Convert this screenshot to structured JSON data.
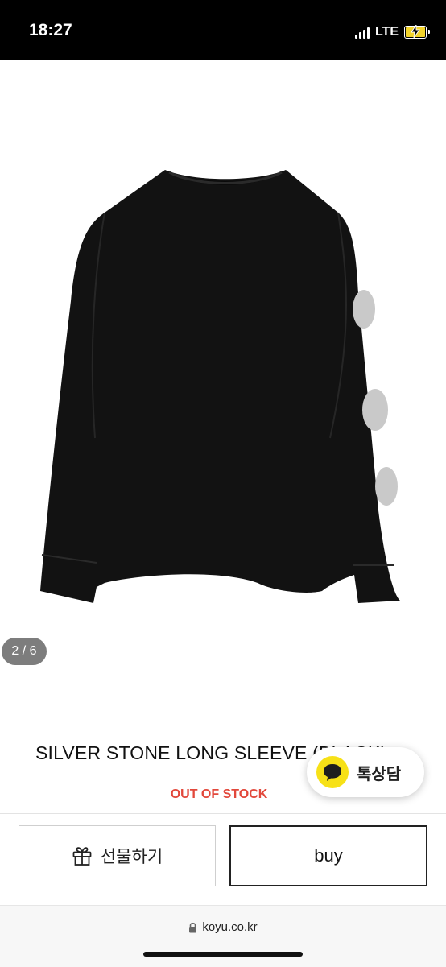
{
  "status_bar": {
    "time": "18:27",
    "network": "LTE",
    "battery_color": "#f2d32b"
  },
  "gallery": {
    "counter": "2 / 6",
    "product_image": "black-long-sleeve-tshirt"
  },
  "product": {
    "title": "SILVER STONE LONG SLEEVE (BLACK)",
    "stock_status": "OUT OF STOCK",
    "stock_color": "#e2483b"
  },
  "chat": {
    "label": "톡상담",
    "icon": "speech-bubble-icon",
    "accent": "#f7e117"
  },
  "actions": {
    "gift_label": "선물하기",
    "gift_icon": "gift-icon",
    "buy_label": "buy"
  },
  "browser": {
    "url": "koyu.co.kr",
    "lock_icon": "lock-icon"
  }
}
